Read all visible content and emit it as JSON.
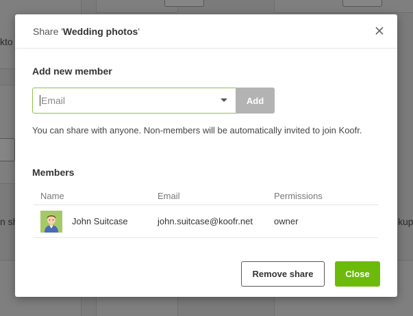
{
  "background": {
    "left_text_1": "kto",
    "left_text_2": "n sh",
    "right_text": "kup"
  },
  "modal": {
    "title_prefix": "Share '",
    "title_name": "Wedding photos",
    "title_suffix": "'",
    "close_icon": "close-icon",
    "add_section_title": "Add new member",
    "email_placeholder": "Email",
    "add_label": "Add",
    "hint": "You can share with anyone. Non-members will be automatically invited to join Koofr.",
    "members_title": "Members",
    "columns": [
      "Name",
      "Email",
      "Permissions"
    ],
    "members": [
      {
        "name": "John Suitcase",
        "email": "john.suitcase@koofr.net",
        "permission": "owner",
        "avatar": "user-avatar"
      }
    ],
    "remove_label": "Remove share",
    "close_label": "Close"
  },
  "colors": {
    "primary": "#6cbb0a",
    "input_focus": "#8ac34a",
    "add_disabled": "#b3b3b3"
  }
}
